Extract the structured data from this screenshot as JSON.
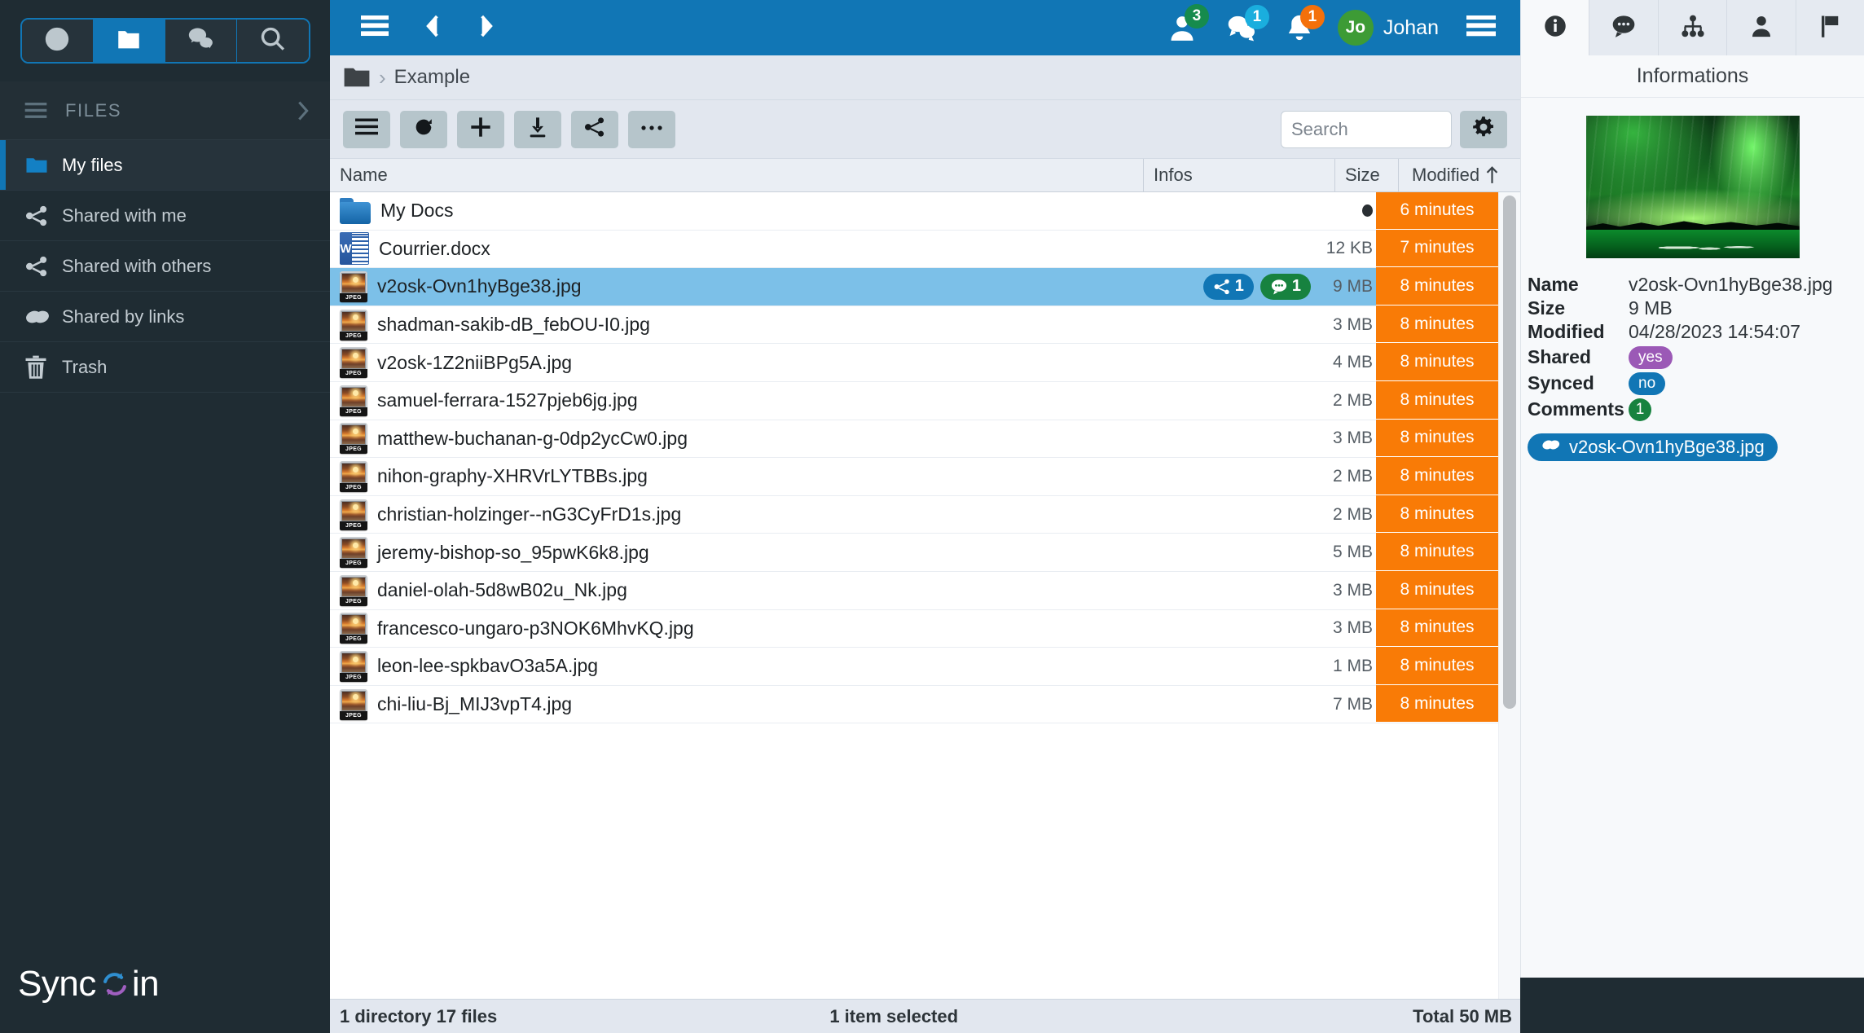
{
  "brand": {
    "name_part1": "Sync",
    "name_part2": "in",
    "logo_icon": "sync-refresh-icon"
  },
  "sidebar": {
    "app_tabs": [
      {
        "name": "recent-activity",
        "icon": "clock-icon",
        "active": false
      },
      {
        "name": "files",
        "icon": "folder-icon",
        "active": true
      },
      {
        "name": "comments",
        "icon": "chat-bubbles-icon",
        "active": false
      },
      {
        "name": "search",
        "icon": "search-icon",
        "active": false
      }
    ],
    "section": {
      "label": "FILES",
      "burger_icon": "hamburger-icon",
      "chevron_icon": "chevron-right-icon"
    },
    "items": [
      {
        "label": "My files",
        "icon": "folder-icon",
        "active": true
      },
      {
        "label": "Shared with me",
        "icon": "share-nodes-icon",
        "active": false
      },
      {
        "label": "Shared with others",
        "icon": "share-nodes-icon",
        "active": false
      },
      {
        "label": "Shared by links",
        "icon": "link-chain-icon",
        "active": false
      },
      {
        "label": "Trash",
        "icon": "trash-icon",
        "active": false
      }
    ],
    "accent": "#1176b5"
  },
  "topbar": {
    "menu_icon": "hamburger-icon",
    "back_icon": "chevron-left-icon",
    "forward_icon": "chevron-right-icon",
    "badges": [
      {
        "name": "users-badge",
        "icon": "user-icon",
        "count": "3",
        "color": "#168b4d"
      },
      {
        "name": "messages-badge",
        "icon": "chat-bubbles-icon",
        "count": "1",
        "color": "#1aaede"
      },
      {
        "name": "notifications-badge",
        "icon": "bell-icon",
        "count": "1",
        "color": "#f4700a"
      }
    ],
    "user": {
      "initials": "Jo",
      "name": "Johan",
      "avatar_color": "#3d9b35"
    },
    "right_menu_icon": "hamburger-icon"
  },
  "breadcrumb": {
    "root_icon": "folder-icon",
    "separator": "›",
    "path": "Example"
  },
  "toolbar": {
    "buttons": [
      {
        "name": "view-options-button",
        "icon": "hamburger-icon"
      },
      {
        "name": "refresh-button",
        "icon": "refresh-icon"
      },
      {
        "name": "new-item-button",
        "icon": "plus-icon"
      },
      {
        "name": "download-button",
        "icon": "download-icon"
      },
      {
        "name": "share-button",
        "icon": "share-nodes-icon"
      },
      {
        "name": "more-actions-button",
        "icon": "ellipsis-icon"
      }
    ],
    "search": {
      "placeholder": "Search",
      "value": ""
    },
    "settings": {
      "name": "settings-button",
      "icon": "gear-icon"
    }
  },
  "filelist": {
    "columns": [
      {
        "key": "name",
        "label": "Name"
      },
      {
        "key": "infos",
        "label": "Infos"
      },
      {
        "key": "size",
        "label": "Size"
      },
      {
        "key": "modified",
        "label": "Modified",
        "sort_icon": "arrow-up-icon"
      }
    ],
    "modified_cell_color": "#f97b06",
    "selected_row_color": "#7cc0e8",
    "rows": [
      {
        "name": "My Docs",
        "type": "folder",
        "icon": "folder-icon",
        "size": "",
        "size_dot": true,
        "modified": "6 minutes",
        "selected": false,
        "shares": "",
        "comments": ""
      },
      {
        "name": "Courrier.docx",
        "type": "docx",
        "icon": "word-document-icon",
        "size": "12 KB",
        "size_dot": false,
        "modified": "7 minutes",
        "selected": false,
        "shares": "",
        "comments": ""
      },
      {
        "name": "v2osk-Ovn1hyBge38.jpg",
        "type": "jpeg",
        "icon": "jpeg-image-icon",
        "size": "9 MB",
        "size_dot": false,
        "modified": "8 minutes",
        "selected": true,
        "shares": "1",
        "comments": "1"
      },
      {
        "name": "shadman-sakib-dB_febOU-I0.jpg",
        "type": "jpeg",
        "icon": "jpeg-image-icon",
        "size": "3 MB",
        "size_dot": false,
        "modified": "8 minutes",
        "selected": false,
        "shares": "",
        "comments": ""
      },
      {
        "name": "v2osk-1Z2niiBPg5A.jpg",
        "type": "jpeg",
        "icon": "jpeg-image-icon",
        "size": "4 MB",
        "size_dot": false,
        "modified": "8 minutes",
        "selected": false,
        "shares": "",
        "comments": ""
      },
      {
        "name": "samuel-ferrara-1527pjeb6jg.jpg",
        "type": "jpeg",
        "icon": "jpeg-image-icon",
        "size": "2 MB",
        "size_dot": false,
        "modified": "8 minutes",
        "selected": false,
        "shares": "",
        "comments": ""
      },
      {
        "name": "matthew-buchanan-g-0dp2ycCw0.jpg",
        "type": "jpeg",
        "icon": "jpeg-image-icon",
        "size": "3 MB",
        "size_dot": false,
        "modified": "8 minutes",
        "selected": false,
        "shares": "",
        "comments": ""
      },
      {
        "name": "nihon-graphy-XHRVrLYTBBs.jpg",
        "type": "jpeg",
        "icon": "jpeg-image-icon",
        "size": "2 MB",
        "size_dot": false,
        "modified": "8 minutes",
        "selected": false,
        "shares": "",
        "comments": ""
      },
      {
        "name": "christian-holzinger--nG3CyFrD1s.jpg",
        "type": "jpeg",
        "icon": "jpeg-image-icon",
        "size": "2 MB",
        "size_dot": false,
        "modified": "8 minutes",
        "selected": false,
        "shares": "",
        "comments": ""
      },
      {
        "name": "jeremy-bishop-so_95pwK6k8.jpg",
        "type": "jpeg",
        "icon": "jpeg-image-icon",
        "size": "5 MB",
        "size_dot": false,
        "modified": "8 minutes",
        "selected": false,
        "shares": "",
        "comments": ""
      },
      {
        "name": "daniel-olah-5d8wB02u_Nk.jpg",
        "type": "jpeg",
        "icon": "jpeg-image-icon",
        "size": "3 MB",
        "size_dot": false,
        "modified": "8 minutes",
        "selected": false,
        "shares": "",
        "comments": ""
      },
      {
        "name": "francesco-ungaro-p3NOK6MhvKQ.jpg",
        "type": "jpeg",
        "icon": "jpeg-image-icon",
        "size": "3 MB",
        "size_dot": false,
        "modified": "8 minutes",
        "selected": false,
        "shares": "",
        "comments": ""
      },
      {
        "name": "leon-lee-spkbavO3a5A.jpg",
        "type": "jpeg",
        "icon": "jpeg-image-icon",
        "size": "1 MB",
        "size_dot": false,
        "modified": "8 minutes",
        "selected": false,
        "shares": "",
        "comments": ""
      },
      {
        "name": "chi-liu-Bj_MIJ3vpT4.jpg",
        "type": "jpeg",
        "icon": "jpeg-image-icon",
        "size": "7 MB",
        "size_dot": false,
        "modified": "8 minutes",
        "selected": false,
        "shares": "",
        "comments": ""
      }
    ]
  },
  "statusbar": {
    "left": "1 directory 17 files",
    "middle": "1 item selected",
    "right": "Total 50 MB"
  },
  "right_panel": {
    "tabs": [
      {
        "name": "tab-informations",
        "icon": "info-circle-icon",
        "active": true
      },
      {
        "name": "tab-comments",
        "icon": "chat-bubble-icon",
        "active": false
      },
      {
        "name": "tab-shares",
        "icon": "sitemap-icon",
        "active": false
      },
      {
        "name": "tab-owner",
        "icon": "user-icon",
        "active": false
      },
      {
        "name": "tab-flag",
        "icon": "flag-icon",
        "active": false
      }
    ],
    "title": "Informations",
    "preview_alt": "aurora-borealis-thumbnail",
    "properties": [
      {
        "key": "Name",
        "value": "v2osk-Ovn1hyBge38.jpg",
        "kind": "text"
      },
      {
        "key": "Size",
        "value": "9 MB",
        "kind": "text"
      },
      {
        "key": "Modified",
        "value": "04/28/2023 14:54:07",
        "kind": "text"
      },
      {
        "key": "Shared",
        "value": "yes",
        "kind": "tag",
        "tag_color": "purple"
      },
      {
        "key": "Synced",
        "value": "no",
        "kind": "tag",
        "tag_color": "blue"
      },
      {
        "key": "Comments",
        "value": "1",
        "kind": "tag",
        "tag_color": "green"
      }
    ],
    "link_chip": {
      "icon": "link-chain-icon",
      "label": "v2osk-Ovn1hyBge38.jpg"
    }
  }
}
